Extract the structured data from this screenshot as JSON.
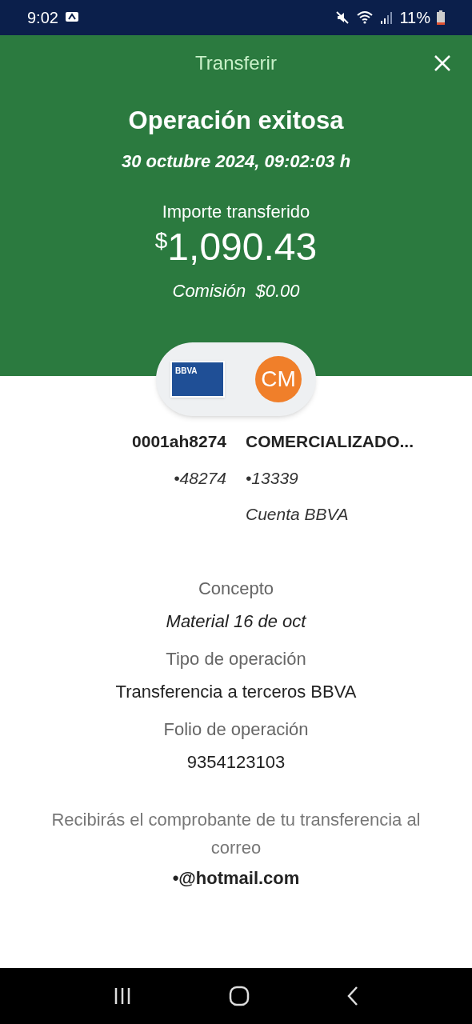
{
  "status_bar": {
    "time": "9:02",
    "battery": "11%"
  },
  "header": {
    "title": "Transferir"
  },
  "result": {
    "title": "Operación exitosa",
    "datetime": "30 octubre 2024, 09:02:03 h",
    "amount_label": "Importe transferido",
    "currency": "$",
    "amount": "1,090.43",
    "commission": "Comisión  $0.00"
  },
  "accounts": {
    "card_brand": "BBVA",
    "recipient_initials": "CM",
    "origin": {
      "name": "0001ah8274",
      "number": "•48274"
    },
    "destination": {
      "name": "COMERCIALIZADO...",
      "number": "•13339",
      "bank": "Cuenta BBVA"
    }
  },
  "details": [
    {
      "label": "Concepto",
      "value": "Material 16 de oct",
      "italic": true
    },
    {
      "label": "Tipo de operación",
      "value": "Transferencia a terceros BBVA",
      "italic": false
    },
    {
      "label": "Folio de operación",
      "value": "9354123103",
      "italic": false
    }
  ],
  "notice": {
    "text": "Recibirás el comprobante de tu transferencia al correo",
    "email": "•@hotmail.com"
  }
}
